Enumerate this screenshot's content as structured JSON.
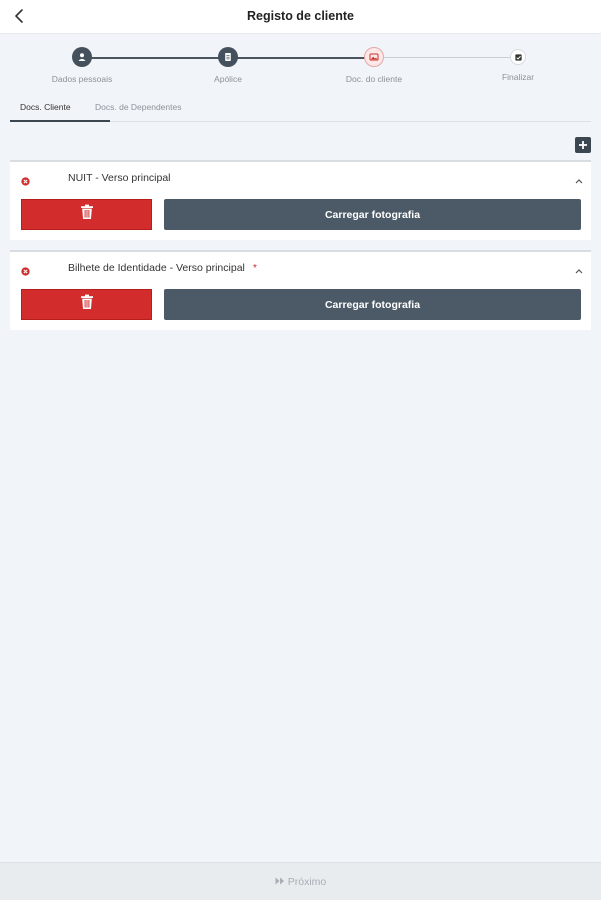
{
  "header": {
    "title": "Registo de cliente",
    "back_icon": "chevron-left-icon"
  },
  "stepper": {
    "steps": [
      {
        "label": "Dados pessoais",
        "state": "done",
        "icon": "person-icon"
      },
      {
        "label": "Apólice",
        "state": "done",
        "icon": "document-icon"
      },
      {
        "label": "Doc. do cliente",
        "state": "current",
        "icon": "image-icon"
      },
      {
        "label": "Finalizar",
        "state": "todo",
        "icon": "check-icon"
      }
    ]
  },
  "tabs": {
    "items": [
      {
        "label": "Docs. Cliente",
        "active": true
      },
      {
        "label": "Docs. de Dependentes",
        "active": false
      }
    ]
  },
  "add_button": {
    "icon": "plus-icon"
  },
  "documents": [
    {
      "title": "NUIT - Verso principal",
      "required_marker": "",
      "status_icon": "error-x-icon",
      "delete_icon": "trash-icon",
      "upload_label": "Carregar fotografia"
    },
    {
      "title": "Bilhete de Identidade - Verso principal",
      "required_marker": "*",
      "status_icon": "error-x-icon",
      "delete_icon": "trash-icon",
      "upload_label": "Carregar fotografia"
    }
  ],
  "footer": {
    "next_label": "Próximo",
    "next_icon": "double-chevron-right-icon",
    "next_enabled": false
  },
  "colors": {
    "background": "#f1f4f8",
    "primary_dark": "#4b5a66",
    "step_done": "#44505c",
    "danger": "#d32c2c",
    "disabled_text": "#a7aeb5"
  }
}
